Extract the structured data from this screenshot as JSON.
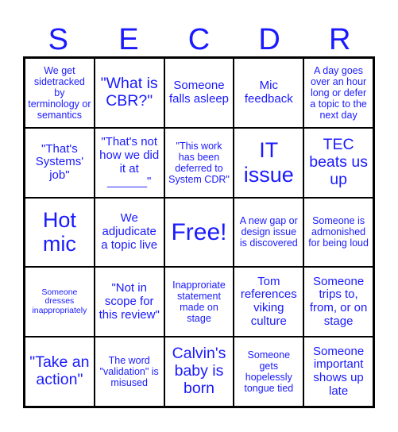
{
  "header": {
    "letters": [
      "S",
      "E",
      "C",
      "D",
      "R"
    ]
  },
  "colors": {
    "text": "#1a1aff",
    "grid": "#000000",
    "background": "#ffffff"
  },
  "board": {
    "rows": [
      [
        "We get sidetracked by terminology or semantics",
        "\"What is CBR?\"",
        "Someone falls asleep",
        "Mic feedback",
        "A day goes over an hour long or defer a topic to the next day"
      ],
      [
        "\"That's Systems' job\"",
        "\"That's not how we did it at ______\"",
        "\"This work has been deferred to System CDR\"",
        "IT issue",
        "TEC beats us up"
      ],
      [
        "Hot mic",
        "We adjudicate a topic live",
        "Free!",
        "A new gap or design issue is discovered",
        "Someone is admonished for being loud"
      ],
      [
        "Someone dresses inappropriately",
        "\"Not in scope for this review\"",
        "Inapproriate statement made on stage",
        "Tom references viking culture",
        "Someone trips to, from, or on stage"
      ],
      [
        "\"Take an action\"",
        "The word \"validation\" is misused",
        "Calvin's baby is born",
        "Someone gets hopelessly tongue tied",
        "Someone important shows up late"
      ]
    ]
  }
}
